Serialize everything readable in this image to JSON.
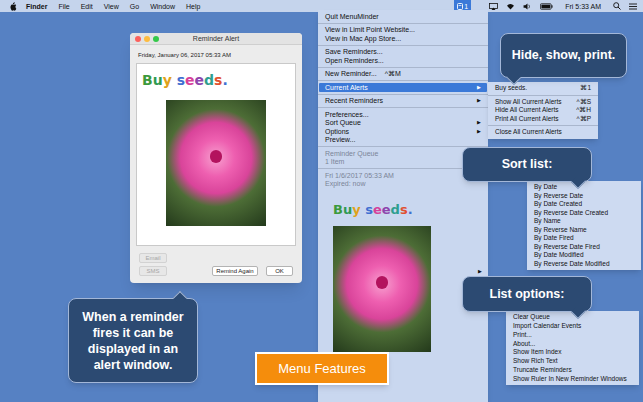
{
  "menubar": {
    "menus": [
      {
        "label": "Finder",
        "kind": "app"
      },
      {
        "label": "File",
        "kind": "menu"
      },
      {
        "label": "Edit",
        "kind": "menu"
      },
      {
        "label": "View",
        "kind": "menu"
      },
      {
        "label": "Go",
        "kind": "menu"
      },
      {
        "label": "Window",
        "kind": "menu"
      },
      {
        "label": "Help",
        "kind": "menu"
      }
    ],
    "status_item": {
      "label": "1",
      "selected": true
    },
    "clock": "Fri 5:33 AM"
  },
  "alert_window": {
    "title": "Reminder Alert",
    "date": "Friday, January 06, 2017 05:33 AM",
    "message": "Buy seeds.",
    "buttons": [
      {
        "label": "Email",
        "disabled": true
      },
      {
        "label": "SMS",
        "disabled": true
      },
      {
        "label": "Remind Again",
        "disabled": false
      },
      {
        "label": "OK",
        "disabled": false
      }
    ]
  },
  "main_menu": {
    "items": [
      {
        "kind": "item",
        "label": "Quit MenuMinder",
        "selected": false,
        "disabled": false
      },
      {
        "kind": "separator"
      },
      {
        "kind": "item",
        "label": "View in Limit Point Website...",
        "selected": false,
        "disabled": false
      },
      {
        "kind": "item",
        "label": "View in Mac App Store...",
        "selected": false,
        "disabled": false
      },
      {
        "kind": "separator"
      },
      {
        "kind": "item",
        "label": "Save Reminders...",
        "selected": false,
        "disabled": false
      },
      {
        "kind": "item",
        "label": "Open Reminders...",
        "selected": false,
        "disabled": false
      },
      {
        "kind": "separator"
      },
      {
        "kind": "item",
        "label": "New Reminder...",
        "shortcut": "^⌘M",
        "selected": false,
        "disabled": false
      },
      {
        "kind": "separator"
      },
      {
        "kind": "item",
        "label": "Current Alerts",
        "arrow": "▶",
        "selected": true,
        "disabled": false
      },
      {
        "kind": "separator"
      },
      {
        "kind": "item",
        "label": "Recent Reminders",
        "arrow": "▶",
        "selected": false,
        "disabled": false
      },
      {
        "kind": "separator"
      },
      {
        "kind": "item",
        "label": "Preferences...",
        "selected": false,
        "disabled": false
      },
      {
        "kind": "item",
        "label": "Sort Queue",
        "arrow": "▶",
        "selected": false,
        "disabled": false
      },
      {
        "kind": "item",
        "label": "Options",
        "arrow": "▶",
        "selected": false,
        "disabled": false
      },
      {
        "kind": "item",
        "label": "Preview...",
        "selected": false,
        "disabled": false
      },
      {
        "kind": "separator"
      },
      {
        "kind": "item",
        "label": "Reminder Queue",
        "selected": false,
        "disabled": true
      },
      {
        "kind": "item",
        "label": "1 Item",
        "selected": false,
        "disabled": true
      },
      {
        "kind": "separator"
      },
      {
        "kind": "item",
        "label": "Fri 1/6/2017 05:33 AM",
        "selected": false,
        "disabled": true
      },
      {
        "kind": "item",
        "label": "Expired: now",
        "selected": false,
        "disabled": true
      }
    ],
    "preview": {
      "message": "Buy seeds.",
      "arrow": "▶"
    }
  },
  "current_alerts_menu": {
    "items": [
      {
        "kind": "item",
        "label": "Buy seeds.",
        "shortcut": "⌘1",
        "selected": false,
        "disabled": false
      },
      {
        "kind": "separator"
      },
      {
        "kind": "item",
        "label": "Show All Current Alerts",
        "shortcut": "^⌘S",
        "selected": false,
        "disabled": false
      },
      {
        "kind": "item",
        "label": "Hide All Current Alerts",
        "shortcut": "^⌘H",
        "selected": false,
        "disabled": false
      },
      {
        "kind": "item",
        "label": "Print All Current Alerts",
        "shortcut": "^⌘P",
        "selected": false,
        "disabled": false
      },
      {
        "kind": "separator"
      },
      {
        "kind": "item",
        "label": "Close All Current Alerts",
        "selected": false,
        "disabled": false
      }
    ]
  },
  "sort_menu": {
    "items": [
      {
        "kind": "item",
        "label": "By Date",
        "selected": false,
        "disabled": false
      },
      {
        "kind": "item",
        "label": "By Reverse Date",
        "selected": false,
        "disabled": false
      },
      {
        "kind": "item",
        "label": "By Date Created",
        "selected": false,
        "disabled": false
      },
      {
        "kind": "item",
        "label": "By Reverse Date Created",
        "selected": false,
        "disabled": false
      },
      {
        "kind": "item",
        "label": "By Name",
        "selected": false,
        "disabled": false
      },
      {
        "kind": "item",
        "label": "By Reverse Name",
        "selected": false,
        "disabled": false
      },
      {
        "kind": "item",
        "label": "By Date Fired",
        "selected": false,
        "disabled": false
      },
      {
        "kind": "item",
        "label": "By Reverse Date Fired",
        "selected": false,
        "disabled": false
      },
      {
        "kind": "item",
        "label": "By Date Modified",
        "selected": false,
        "disabled": false
      },
      {
        "kind": "item",
        "label": "By Reverse Date Modified",
        "selected": false,
        "disabled": false
      }
    ]
  },
  "options_menu": {
    "items": [
      {
        "kind": "item",
        "label": "Clear Queue",
        "selected": false,
        "disabled": false
      },
      {
        "kind": "item",
        "label": "Import Calendar Events",
        "selected": false,
        "disabled": false
      },
      {
        "kind": "item",
        "label": "Print...",
        "selected": false,
        "disabled": false
      },
      {
        "kind": "item",
        "label": "About...",
        "selected": false,
        "disabled": false
      },
      {
        "kind": "item",
        "label": "Show Item Index",
        "selected": false,
        "disabled": false
      },
      {
        "kind": "item",
        "label": "Show Rich Text",
        "selected": false,
        "disabled": false
      },
      {
        "kind": "item",
        "label": "Truncate Reminders",
        "selected": false,
        "disabled": false
      },
      {
        "kind": "item",
        "label": "Show Ruler In New Reminder Windows",
        "selected": false,
        "disabled": false
      }
    ]
  },
  "callouts": [
    {
      "text": "Hide, show, print."
    },
    {
      "text": "Sort list:"
    },
    {
      "text": "List options:"
    },
    {
      "text": "When a reminder fires it can be displayed in an alert window."
    }
  ],
  "banner": "Menu Features"
}
